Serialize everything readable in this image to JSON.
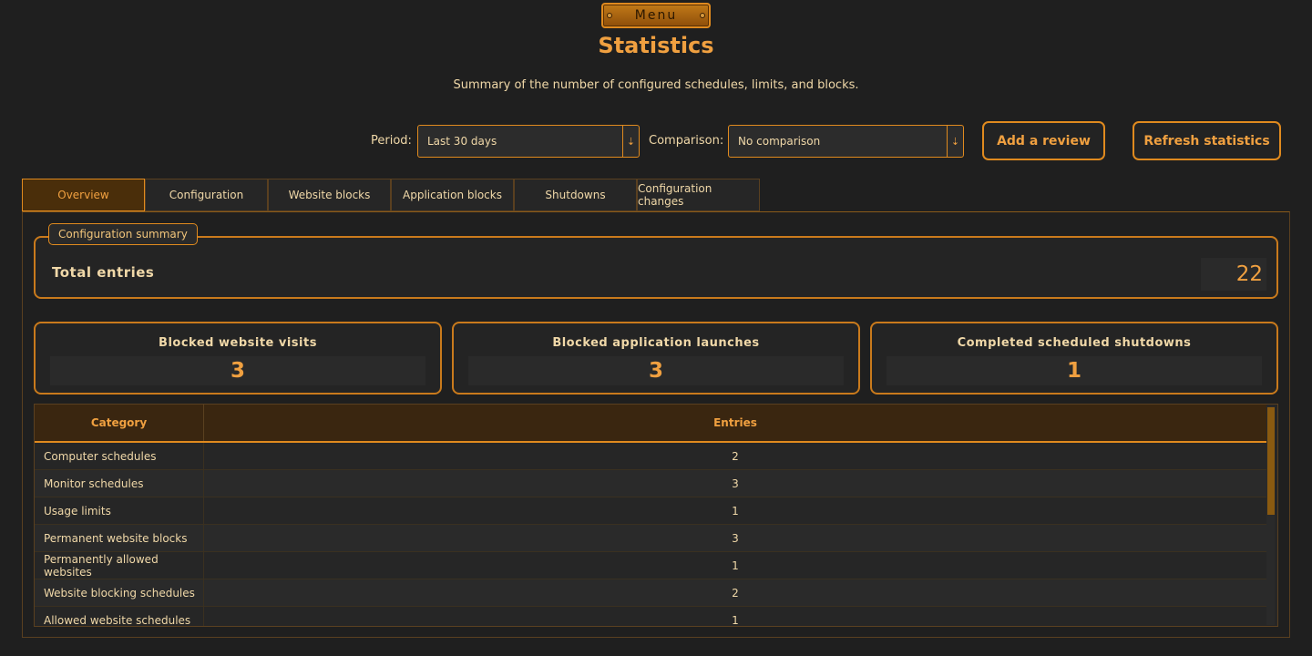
{
  "header": {
    "menu_label": "Menu",
    "title": "Statistics",
    "subtitle": "Summary of the number of configured schedules, limits, and blocks."
  },
  "filters": {
    "period_label": "Period:",
    "period_value": "Last 30 days",
    "comparison_label": "Comparison:",
    "comparison_value": "No comparison",
    "add_review_label": "Add a review",
    "refresh_label": "Refresh statistics"
  },
  "tabs": [
    {
      "label": "Overview",
      "active": true
    },
    {
      "label": "Configuration",
      "active": false
    },
    {
      "label": "Website blocks",
      "active": false
    },
    {
      "label": "Application blocks",
      "active": false
    },
    {
      "label": "Shutdowns",
      "active": false
    },
    {
      "label": "Configuration changes",
      "active": false
    }
  ],
  "summary": {
    "legend": "Configuration summary",
    "total_label": "Total entries",
    "total_value": "22"
  },
  "cards": [
    {
      "label": "Blocked website visits",
      "value": "3"
    },
    {
      "label": "Blocked application launches",
      "value": "3"
    },
    {
      "label": "Completed scheduled shutdowns",
      "value": "1"
    }
  ],
  "table": {
    "headers": [
      "Category",
      "Entries"
    ],
    "rows": [
      [
        "Computer schedules",
        "2"
      ],
      [
        "Monitor schedules",
        "3"
      ],
      [
        "Usage limits",
        "1"
      ],
      [
        "Permanent website blocks",
        "3"
      ],
      [
        "Permanently allowed websites",
        "1"
      ],
      [
        "Website blocking schedules",
        "2"
      ],
      [
        "Allowed website schedules",
        "1"
      ]
    ]
  },
  "colors": {
    "accent": "#e08a1e",
    "title": "#f0a040",
    "background": "#1f1f1f"
  }
}
